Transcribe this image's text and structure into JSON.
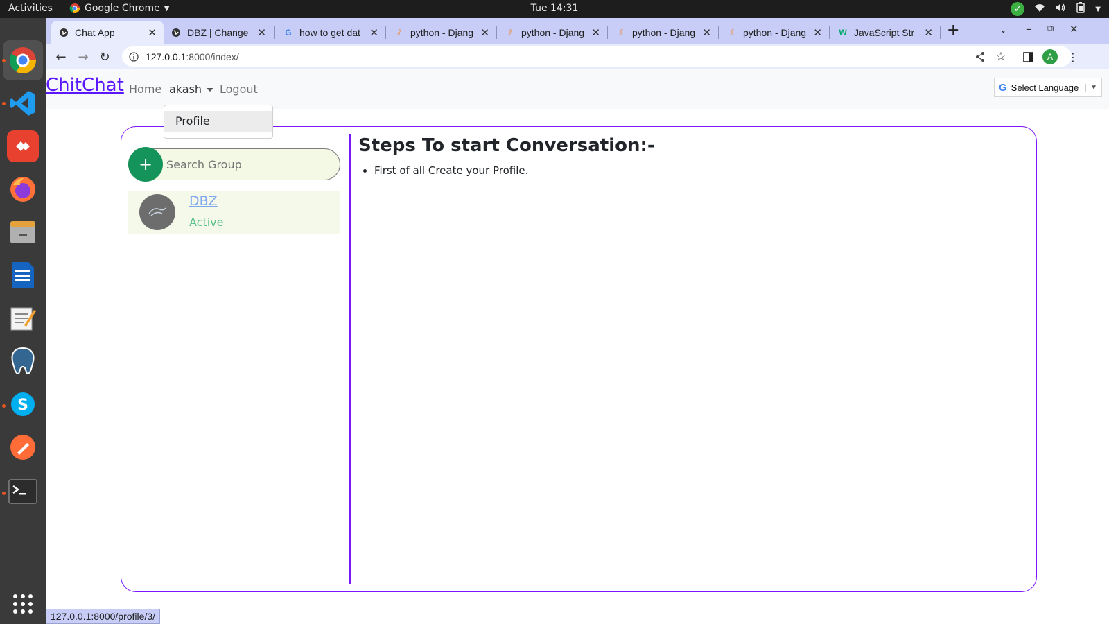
{
  "system": {
    "activities": "Activities",
    "app_name": "Google Chrome",
    "clock": "Tue 14:31"
  },
  "browser": {
    "tabs": [
      {
        "title": "Chat App"
      },
      {
        "title": "DBZ | Change"
      },
      {
        "title": "how to get dat"
      },
      {
        "title": "python - Djang"
      },
      {
        "title": "python - Djang"
      },
      {
        "title": "python - Djang"
      },
      {
        "title": "python - Djang"
      },
      {
        "title": "JavaScript Str"
      }
    ],
    "url": "127.0.0.1:8000/index/",
    "url_host": "127.0.0.1",
    "url_path": ":8000/index/",
    "profile_initial": "A",
    "status_url": "127.0.0.1:8000/profile/3/"
  },
  "navbar": {
    "brand": "ChitChat",
    "home": "Home",
    "user": "akash",
    "logout": "Logout",
    "dropdown_item": "Profile",
    "language": "Select Language"
  },
  "sidebar": {
    "search_placeholder": "Search Group",
    "add_symbol": "+",
    "groups": [
      {
        "name": "DBZ",
        "status": "Active"
      }
    ]
  },
  "main": {
    "title": "Steps To start Conversation:-",
    "steps": [
      "First of all Create your Profile."
    ]
  },
  "colors": {
    "brand": "#5b17ff",
    "card_border": "#7a17ff",
    "add_button": "#14935a",
    "status_active": "#59c08a"
  }
}
